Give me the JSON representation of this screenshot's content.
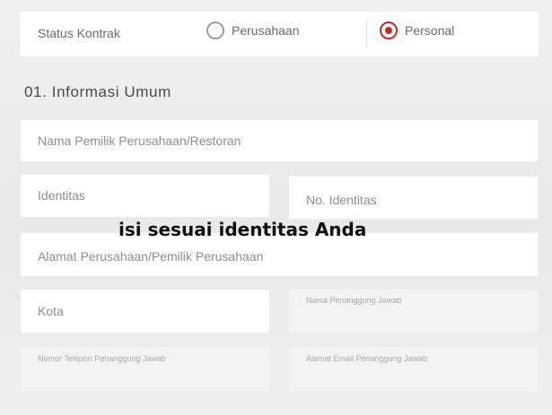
{
  "status": {
    "label": "Status Kontrak",
    "options": [
      {
        "label": "Perusahaan",
        "checked": false
      },
      {
        "label": "Personal",
        "checked": true
      }
    ],
    "accent_color": "#c62828"
  },
  "section": {
    "title": "01. Informasi Umum"
  },
  "fields": {
    "owner_name": {
      "placeholder": "Nama Pemilik Perusahaan/Restoran"
    },
    "identity": {
      "placeholder": "Identitas"
    },
    "identity_no": {
      "placeholder": "No. Identitas"
    },
    "address": {
      "placeholder": "Alamat Perusahaan/Pemilik Perusahaan"
    },
    "city": {
      "placeholder": "Kota"
    },
    "pic_name": {
      "placeholder": "Nama Penanggung Jawab"
    },
    "pic_phone": {
      "placeholder": "Nomor Telepon Penanggung Jawab"
    },
    "pic_email": {
      "placeholder": "Alamat Email Penanggung Jawab"
    }
  },
  "overlay_text": "isi sesuai identitas Anda"
}
